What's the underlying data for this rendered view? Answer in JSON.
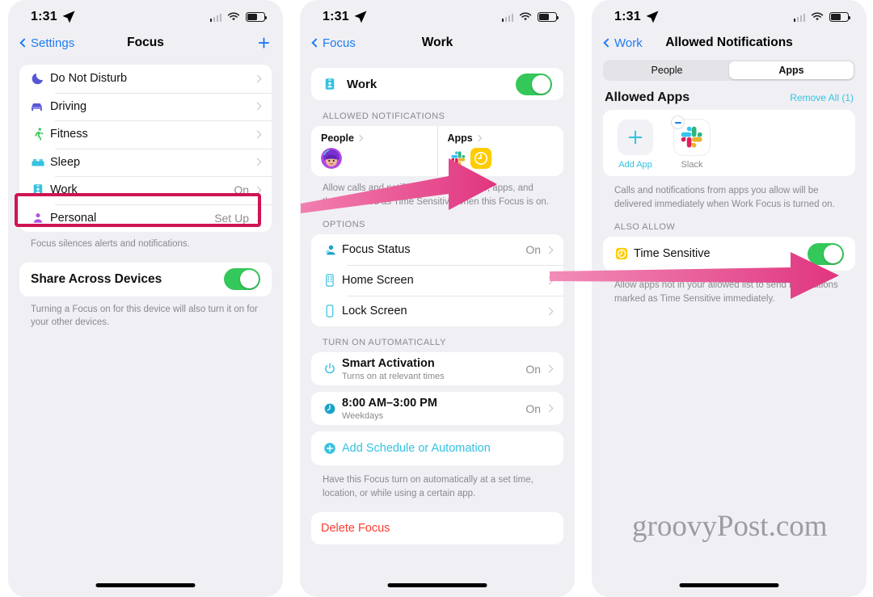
{
  "statusbar": {
    "time": "1:31",
    "location_icon": "location-arrow-icon",
    "cellular_icon": "cellular-bars-icon",
    "wifi_icon": "wifi-icon",
    "battery_icon": "battery-icon"
  },
  "watermark": "groovyPost.com",
  "colors": {
    "accent_blue": "#1e7bf5",
    "teal": "#35c2e0",
    "green": "#34c759",
    "red": "#ff3b30",
    "highlight": "#cf1452",
    "arrow": "#e0357f"
  },
  "panel1": {
    "nav": {
      "back_label": "Settings",
      "title": "Focus",
      "add_label": "+"
    },
    "focus_list": [
      {
        "label": "Do Not Disturb",
        "value": "",
        "icon": "moon-icon",
        "color": "#5756d6"
      },
      {
        "label": "Driving",
        "value": "",
        "icon": "car-icon",
        "color": "#5856d6"
      },
      {
        "label": "Fitness",
        "value": "",
        "icon": "running-person-icon",
        "color": "#34c759"
      },
      {
        "label": "Sleep",
        "value": "",
        "icon": "bed-icon",
        "color": "#35c2e0"
      },
      {
        "label": "Work",
        "value": "On",
        "icon": "id-badge-icon",
        "color": "#35c2e0"
      },
      {
        "label": "Personal",
        "value": "Set Up",
        "icon": "person-icon",
        "color": "#af52de"
      }
    ],
    "list_footnote": "Focus silences alerts and notifications.",
    "share": {
      "label": "Share Across Devices",
      "toggle_on": true
    },
    "share_footnote": "Turning a Focus on for this device will also turn it on for your other devices."
  },
  "panel2": {
    "nav": {
      "back_label": "Focus",
      "title": "Work"
    },
    "work_toggle_row": {
      "label": "Work",
      "icon": "id-badge-icon",
      "toggle_on": true
    },
    "allowed_header": "ALLOWED NOTIFICATIONS",
    "cards": [
      {
        "title": "People",
        "icons": [
          "memoji-avatar"
        ]
      },
      {
        "title": "Apps",
        "icons": [
          "slack-icon",
          "clock-app-icon"
        ]
      }
    ],
    "allowed_footnote": "Allow calls and notifications from people, apps, and those marked as Time Sensitive when this Focus is on.",
    "options_header": "OPTIONS",
    "options": [
      {
        "label": "Focus Status",
        "value": "On",
        "icon": "focus-status-icon"
      },
      {
        "label": "Home Screen",
        "value": "",
        "icon": "home-screen-icon"
      },
      {
        "label": "Lock Screen",
        "value": "",
        "icon": "lock-screen-icon"
      }
    ],
    "auto_header": "TURN ON AUTOMATICALLY",
    "schedules": [
      {
        "title": "Smart Activation",
        "sub": "Turns on at relevant times",
        "value": "On",
        "icon": "power-icon"
      },
      {
        "title": "8:00 AM–3:00 PM",
        "sub": "Weekdays",
        "value": "On",
        "icon": "clock-icon"
      }
    ],
    "add_schedule_label": "Add Schedule or Automation",
    "auto_footnote": "Have this Focus turn on automatically at a set time, location, or while using a certain app.",
    "delete_label": "Delete Focus"
  },
  "panel3": {
    "nav": {
      "back_label": "Work",
      "title": "Allowed Notifications"
    },
    "segments": [
      {
        "label": "People",
        "active": false
      },
      {
        "label": "Apps",
        "active": true
      }
    ],
    "allowed_apps_title": "Allowed Apps",
    "remove_all_label": "Remove All (1)",
    "apps": [
      {
        "label": "Add App",
        "icon": "plus-icon",
        "is_add": true
      },
      {
        "label": "Slack",
        "icon": "slack-icon",
        "is_add": false
      }
    ],
    "apps_footnote": "Calls and notifications from apps you allow will be delivered immediately when Work Focus is turned on.",
    "also_allow_header": "ALSO ALLOW",
    "time_sensitive": {
      "label": "Time Sensitive",
      "icon": "time-sensitive-icon",
      "toggle_on": true
    },
    "time_sensitive_footnote": "Allow apps not in your allowed list to send notifications marked as Time Sensitive immediately."
  }
}
